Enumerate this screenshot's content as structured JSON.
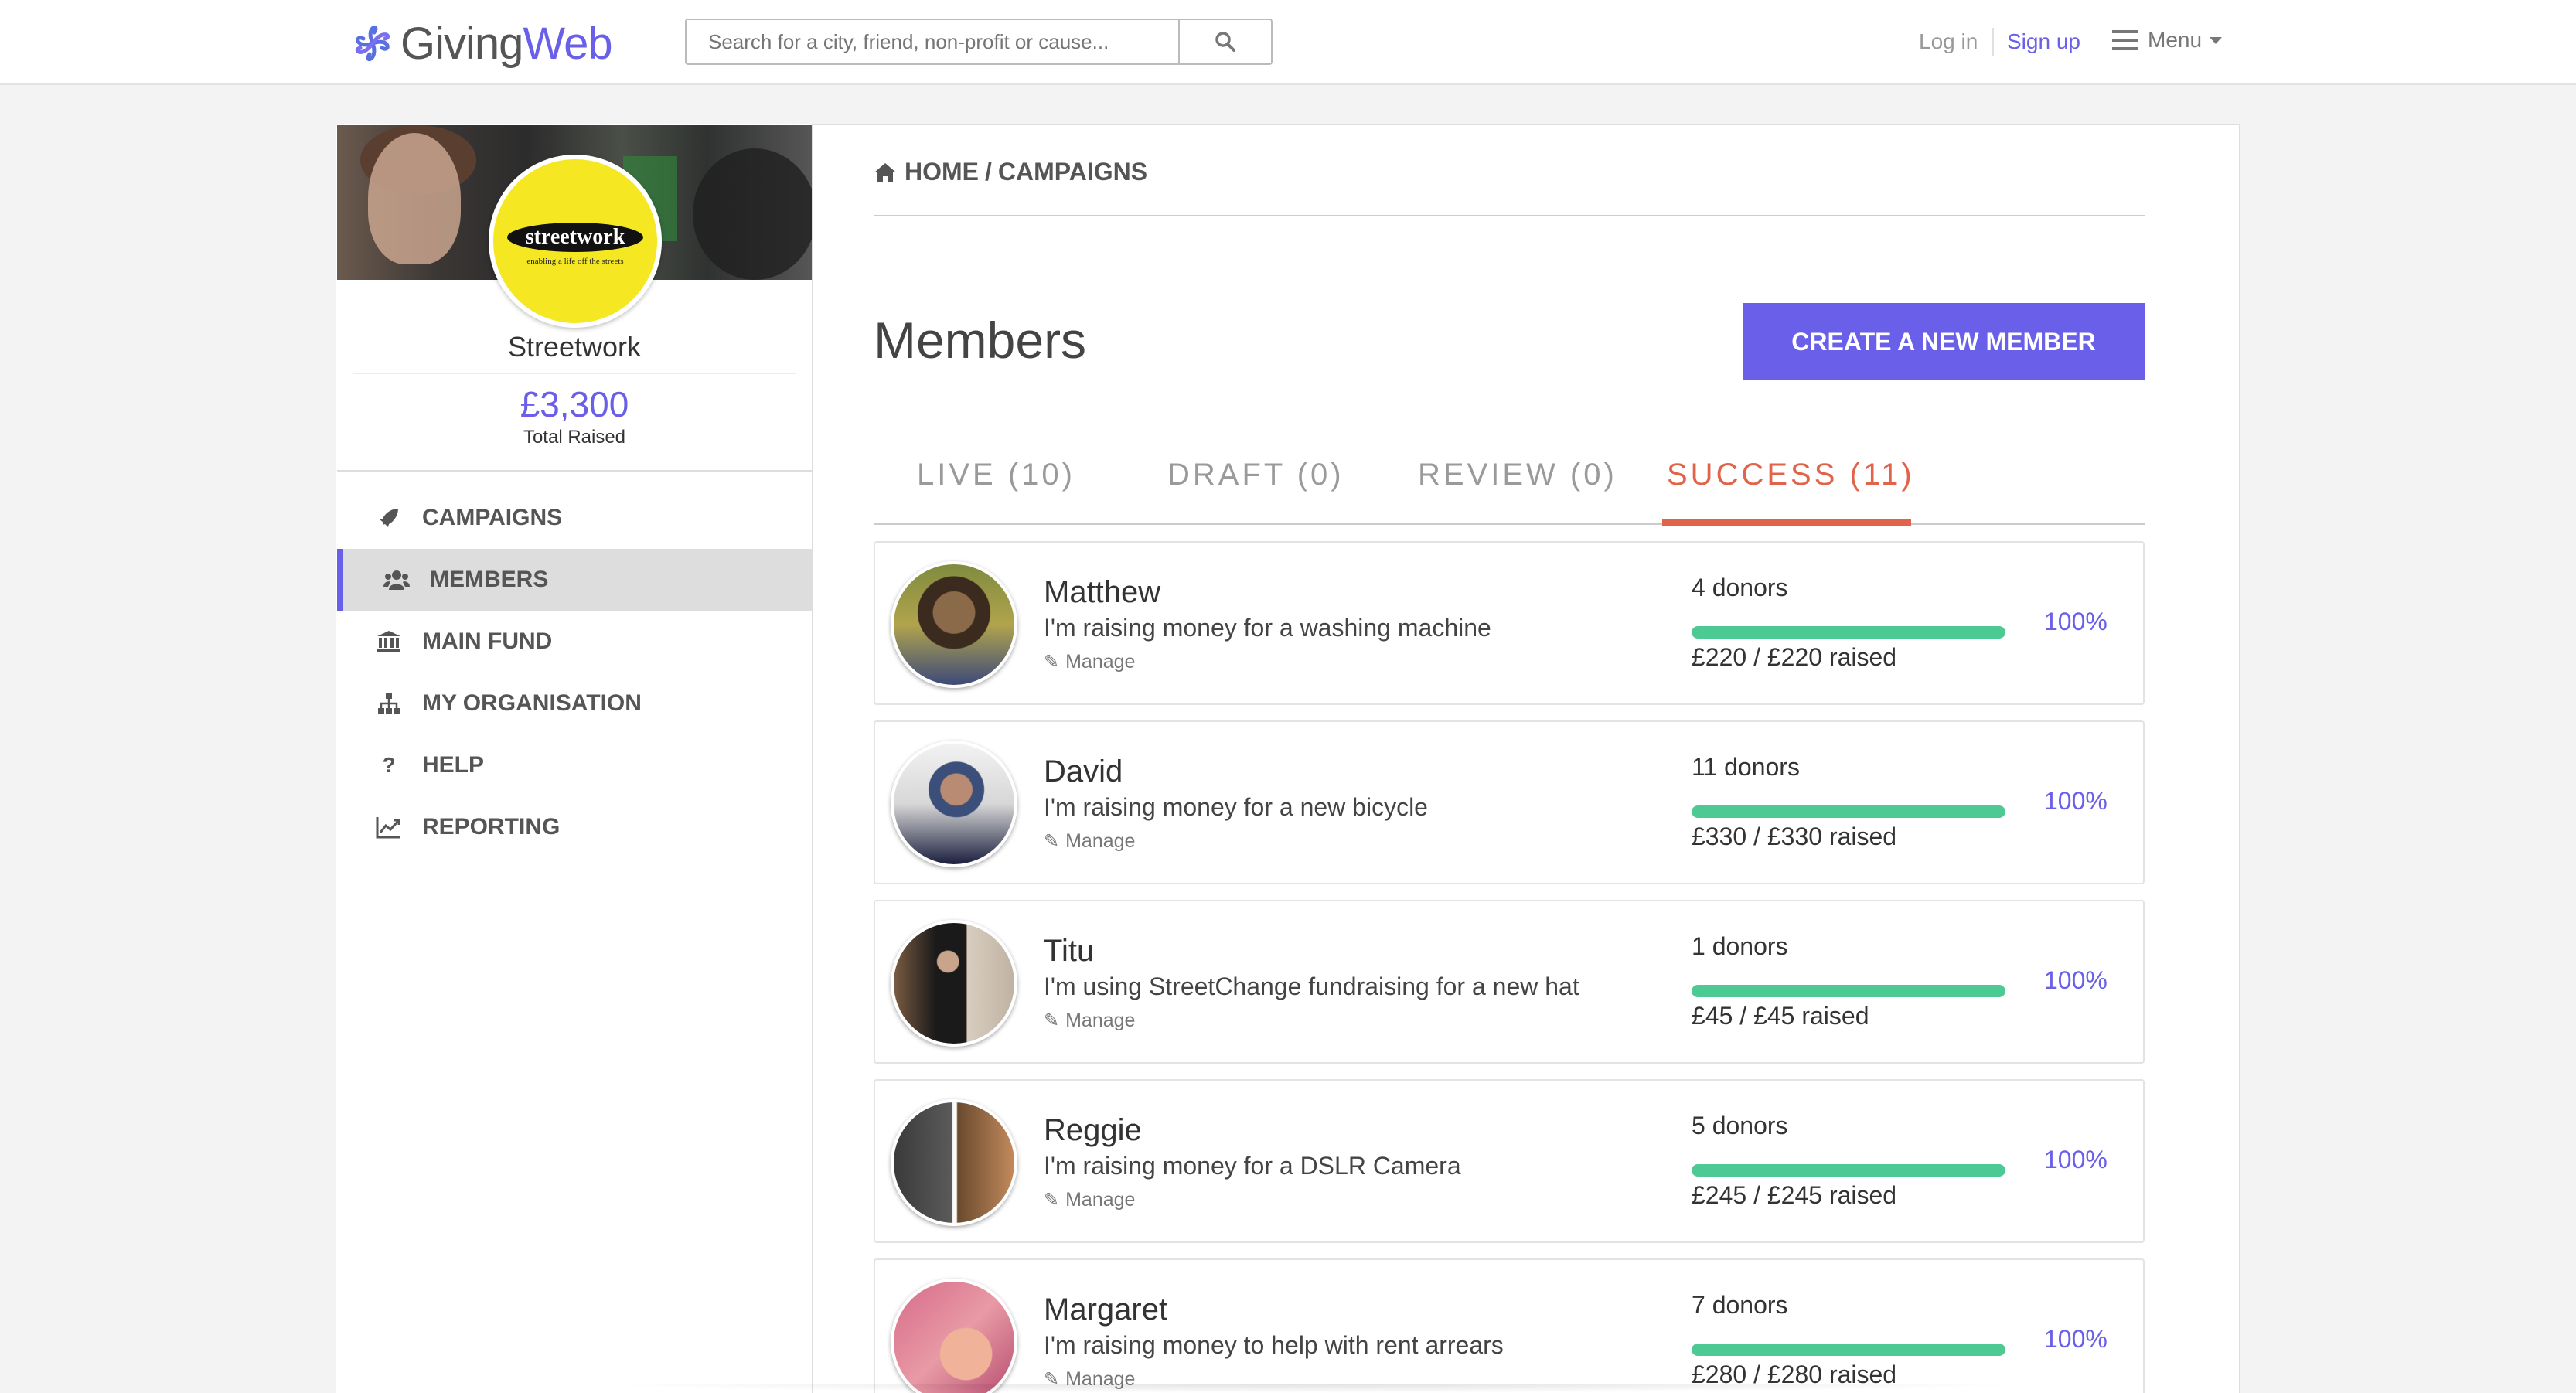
{
  "brand": {
    "part1": "Giving",
    "part2": "Web",
    "accent": "#6a5fe8"
  },
  "search": {
    "placeholder": "Search for a city, friend, non-profit or cause..."
  },
  "header": {
    "login": "Log in",
    "signup": "Sign up",
    "menu": "Menu"
  },
  "org": {
    "logo_text": "streetwork",
    "logo_tagline": "enabling a life off the streets",
    "name": "Streetwork",
    "raised": "£3,300",
    "raised_label": "Total Raised"
  },
  "sidebar": {
    "items": [
      {
        "label": "CAMPAIGNS",
        "icon": "rocket-icon"
      },
      {
        "label": "MEMBERS",
        "icon": "users-icon",
        "active": true
      },
      {
        "label": "MAIN FUND",
        "icon": "bank-icon"
      },
      {
        "label": "MY ORGANISATION",
        "icon": "sitemap-icon"
      },
      {
        "label": "HELP",
        "icon": "question-icon"
      },
      {
        "label": "REPORTING",
        "icon": "line-chart-icon"
      }
    ]
  },
  "breadcrumb": {
    "home": "HOME",
    "separator": "/",
    "current": "CAMPAIGNS"
  },
  "main": {
    "title": "Members",
    "create_button": "CREATE A NEW MEMBER",
    "tabs": [
      {
        "label": "LIVE (10)"
      },
      {
        "label": "DRAFT (0)"
      },
      {
        "label": "REVIEW (0)"
      },
      {
        "label": "SUCCESS (11)",
        "active": true
      }
    ],
    "active_tab_color": "#e0634a",
    "progress_color": "#4dc994",
    "manage_label": "Manage",
    "members": [
      {
        "name": "Matthew",
        "desc": "I'm raising money for a washing machine",
        "donors": "4 donors",
        "raised": "£220 / £220 raised",
        "percent": "100%",
        "progress": 1.0
      },
      {
        "name": "David",
        "desc": "I'm raising money for a new bicycle",
        "donors": "11 donors",
        "raised": "£330 / £330 raised",
        "percent": "100%",
        "progress": 1.0
      },
      {
        "name": "Titu",
        "desc": "I'm using StreetChange fundraising for a new hat",
        "donors": "1 donors",
        "raised": "£45 / £45 raised",
        "percent": "100%",
        "progress": 1.0
      },
      {
        "name": "Reggie",
        "desc": "I'm raising money for a DSLR Camera",
        "donors": "5 donors",
        "raised": "£245 / £245 raised",
        "percent": "100%",
        "progress": 1.0
      },
      {
        "name": "Margaret",
        "desc": "I'm raising money to help with rent arrears",
        "donors": "7 donors",
        "raised": "£280 / £280 raised",
        "percent": "100%",
        "progress": 1.0
      }
    ]
  }
}
